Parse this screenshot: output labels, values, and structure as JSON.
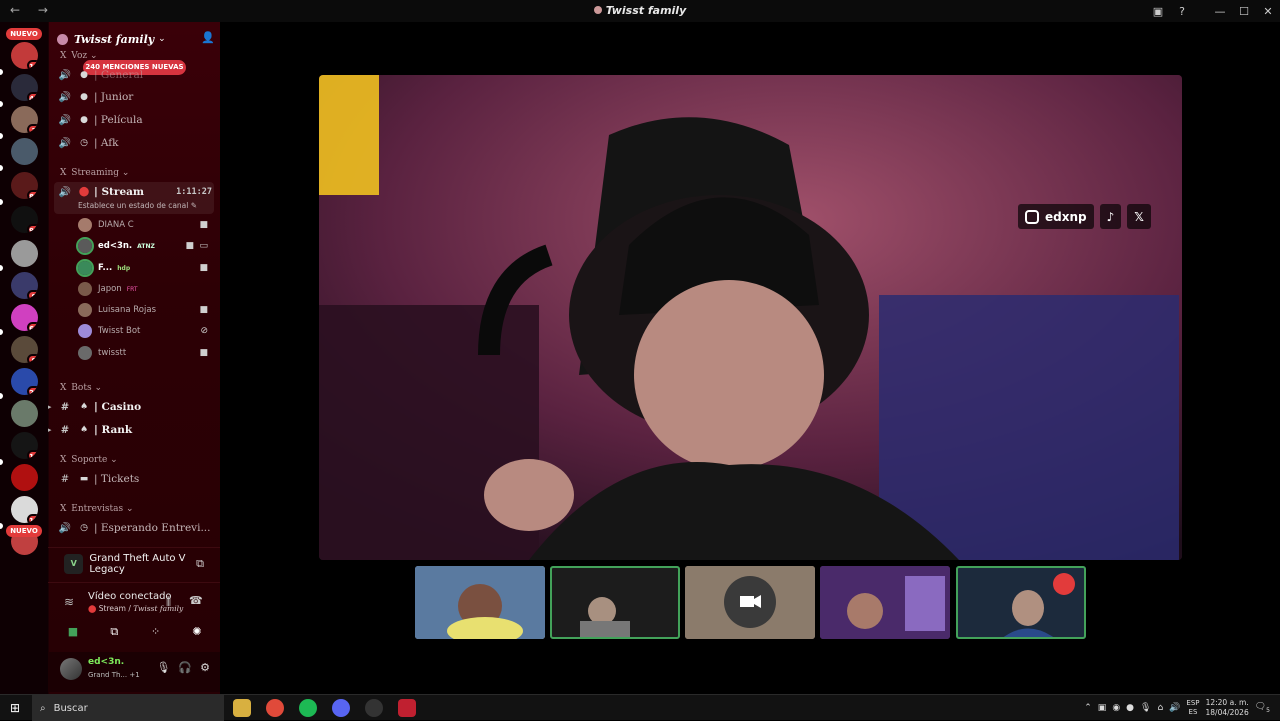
{
  "window": {
    "title": "Twisst family",
    "back": "←",
    "forward": "→"
  },
  "titlebar_icons": {
    "inbox": "inbox-icon",
    "help": "?",
    "min": "—",
    "max": "☐",
    "close": "✕"
  },
  "servers": {
    "nuevo_top": "NUEVO",
    "nuevo_bottom": "NUEVO",
    "badges": [
      "12",
      "47",
      "2",
      "85",
      "92",
      "9",
      "64",
      "9",
      "23",
      "13",
      "12"
    ]
  },
  "guild": {
    "name": "Twisst family",
    "mention_pill": "240 MENCIONES NUEVAS"
  },
  "categories": {
    "voz": "Voz",
    "streaming": "Streaming",
    "bots": "Bots",
    "soporte": "Soporte",
    "entrevistas": "Entrevistas"
  },
  "voice_channels": {
    "general": "| General",
    "junior": "| Junior",
    "pelicula": "| Película",
    "afk": "| Afk"
  },
  "stream_channel": {
    "name": "| Stream",
    "time": "1:11:27",
    "status_hint": "Establece un estado de canal"
  },
  "voice_users": [
    {
      "name": "DIANA C",
      "tag": "",
      "color": "#a57b6c"
    },
    {
      "name": "ed<3n.",
      "tag": "ATNZ",
      "color": "#5a5a5a"
    },
    {
      "name": "F...",
      "tag": "hdp",
      "color": "#3a8a5a"
    },
    {
      "name": "Japon",
      "tag": "FRT",
      "color": "#7a5a4a"
    },
    {
      "name": "Luisana Rojas",
      "tag": "",
      "color": "#8a6a5a"
    },
    {
      "name": "Twisst Bot",
      "tag": "",
      "color": "#9d8ad8"
    },
    {
      "name": "twisstt",
      "tag": "",
      "color": "#6a6a6a"
    }
  ],
  "text_channels": {
    "casino": "| Casino",
    "rank": "| Rank",
    "tickets": "| Tickets",
    "esperando": "| Esperando Entrevi..."
  },
  "activity": {
    "game": "Grand Theft Auto V Legacy",
    "game_logo": "V"
  },
  "voice_connection": {
    "title": "Vídeo conectado",
    "channel": "Stream",
    "guild": "Twisst family",
    "separator": " / "
  },
  "user_panel": {
    "name": "ed<3n.",
    "activity": "Grand Th...",
    "extra": "+1"
  },
  "stream_overlay": {
    "instagram": "edxnp",
    "tiktok": "♪",
    "x": "𝕏"
  },
  "taskbar": {
    "search_placeholder": "Buscar",
    "lang_top": "ESP",
    "lang_bottom": "ES",
    "time": "12:20 a. m.",
    "date": "18/04/2026",
    "notif_count": "5"
  },
  "colors": {
    "accent_red": "#e23b3b",
    "speaking_green": "#43a25a",
    "sidebar": "#2d0005"
  }
}
